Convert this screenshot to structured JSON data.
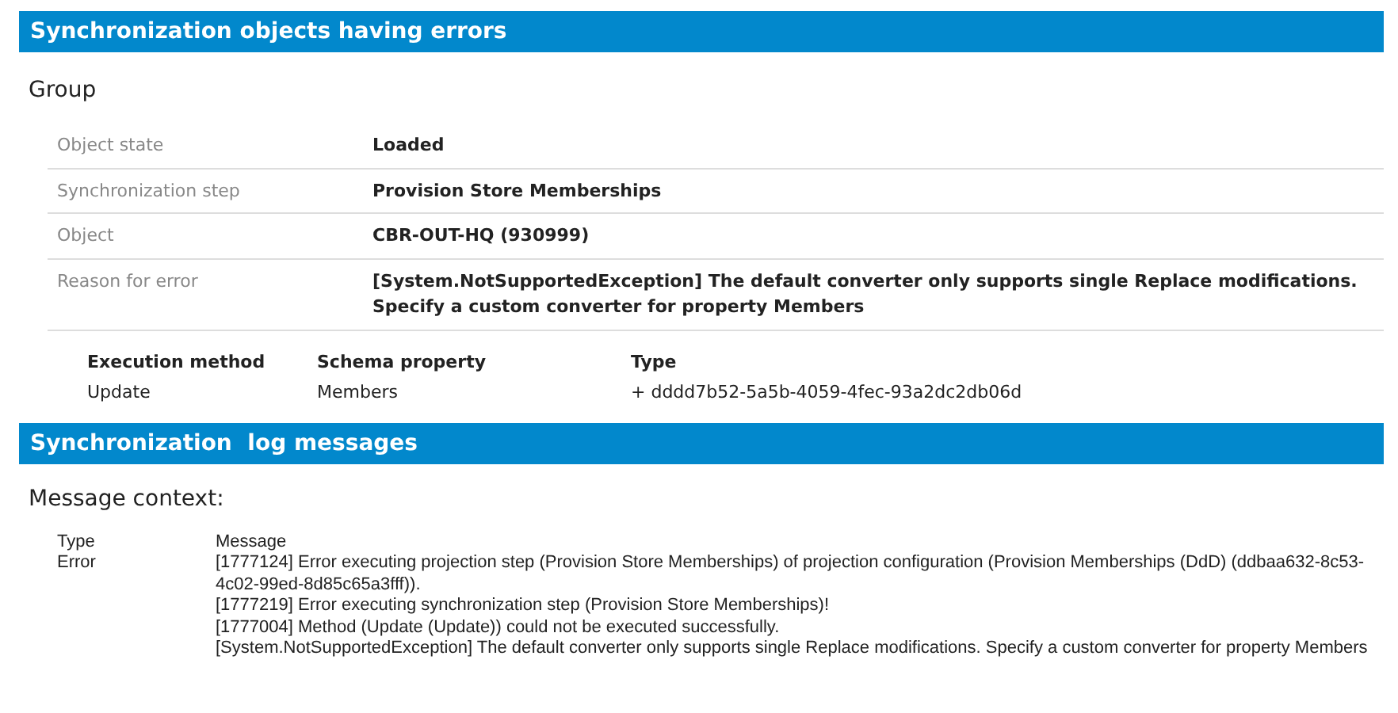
{
  "sections": [
    {
      "title": "Synchronization objects having errors"
    },
    {
      "title": "Synchronization  log messages"
    }
  ],
  "group": {
    "heading": "Group",
    "properties": [
      {
        "label": "Object state",
        "value": "Loaded"
      },
      {
        "label": "Synchronization step",
        "value": "Provision Store Memberships"
      },
      {
        "label": "Object",
        "value": "CBR-OUT-HQ (930999)"
      },
      {
        "label": "Reason for error",
        "value": "[System.NotSupportedException] The default converter only supports single Replace modifications. Specify a custom converter for property Members"
      }
    ],
    "changes": {
      "columns": [
        "Execution method",
        "Schema property",
        "Type"
      ],
      "rows": [
        [
          "Update",
          "Members",
          "+ dddd7b52-5a5b-4059-4fec-93a2dc2db06d"
        ]
      ]
    }
  },
  "log": {
    "heading": "Message context:",
    "columns": [
      "Type",
      "Message"
    ],
    "rows": [
      {
        "type": "Error",
        "messages": [
          "[1777124] Error executing projection step (Provision Store Memberships) of projection configuration (Provision Memberships (DdD) (ddbaa632-8c53-4c02-99ed-8d85c65a3fff)).",
          "[1777219] Error executing synchronization step (Provision Store Memberships)!",
          "[1777004] Method (Update (Update)) could not be executed successfully.",
          "[System.NotSupportedException] The default converter only supports single Replace modifications. Specify a custom converter for property Members"
        ]
      }
    ]
  }
}
